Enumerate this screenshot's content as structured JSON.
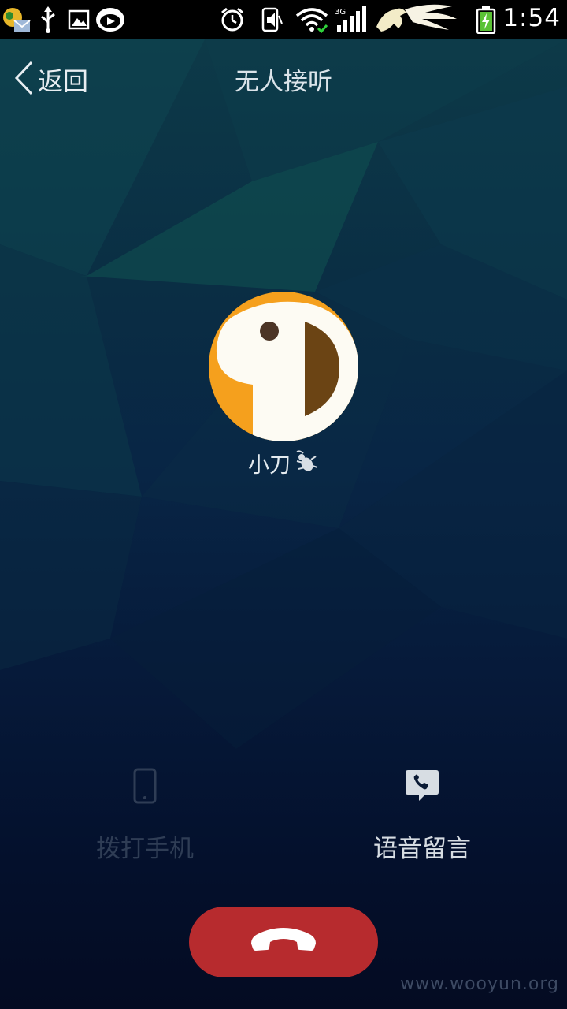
{
  "status_bar": {
    "time": "1:54",
    "network_label": "3G",
    "icons": [
      "notification-icon",
      "usb-icon",
      "image-icon",
      "app-icon",
      "alarm-icon",
      "vibrate-icon",
      "wifi-icon",
      "signal-icon",
      "horse-logo-icon",
      "battery-icon"
    ]
  },
  "header": {
    "back_label": "返回",
    "title": "无人接听"
  },
  "contact": {
    "name": "小刀"
  },
  "actions": {
    "call_mobile": {
      "label": "拨打手机",
      "enabled": false,
      "icon": "phone-icon"
    },
    "voice_message": {
      "label": "语音留言",
      "enabled": true,
      "icon": "voice-message-icon"
    }
  },
  "hangup": {
    "icon": "hangup-icon",
    "color": "#b72b2e"
  },
  "watermark": "www.wooyun.org",
  "colors": {
    "accent_orange": "#f5a01d",
    "avatar_brown": "#6b4414",
    "hangup_red": "#b72b2e"
  }
}
